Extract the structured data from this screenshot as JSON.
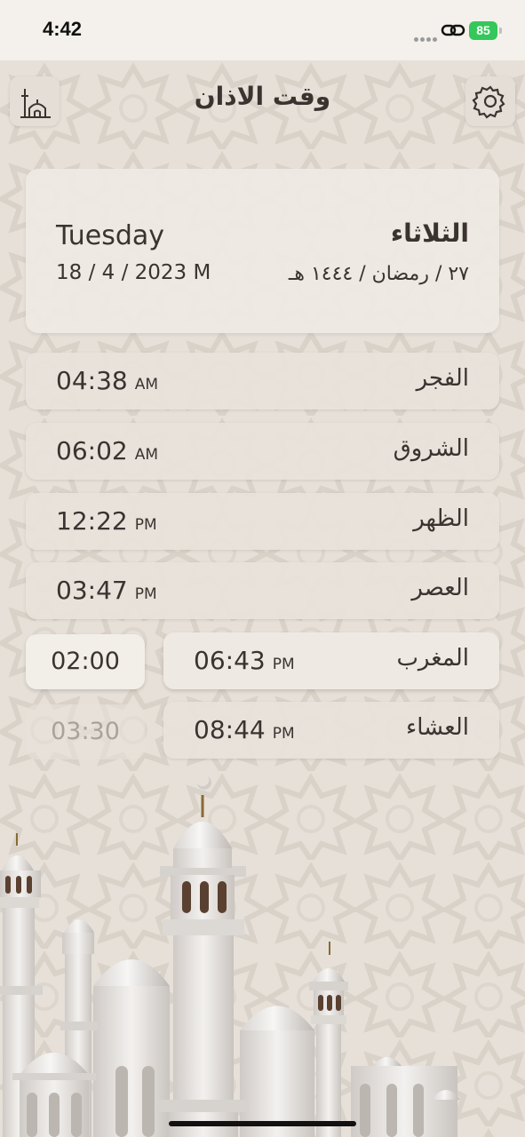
{
  "status": {
    "time": "4:42",
    "battery": "85"
  },
  "header": {
    "title": "وقت الاذان"
  },
  "date": {
    "day_en": "Tuesday",
    "date_en": "18 / 4 / 2023 M",
    "day_ar": "الثلاثاء",
    "date_ar": "٢٧ / رمضان / ١٤٤٤ هـ"
  },
  "prayers": [
    {
      "name": "الفجر",
      "time": "04:38",
      "suffix": "AM"
    },
    {
      "name": "الشروق",
      "time": "06:02",
      "suffix": "AM"
    },
    {
      "name": "الظهر",
      "time": "12:22",
      "suffix": "PM"
    },
    {
      "name": "العصر",
      "time": "03:47",
      "suffix": "PM"
    },
    {
      "name": "المغرب",
      "time": "06:43",
      "suffix": "PM"
    },
    {
      "name": "العشاء",
      "time": "08:44",
      "suffix": "PM"
    }
  ],
  "countdowns": {
    "maghrib": "02:00",
    "isha": "03:30"
  },
  "icons": {
    "left": "mosque-icon",
    "right": "gear-icon"
  },
  "colors": {
    "background": "#ebe6df",
    "card": "#e8e2db",
    "text": "#3a3330",
    "battery": "#34c759"
  }
}
